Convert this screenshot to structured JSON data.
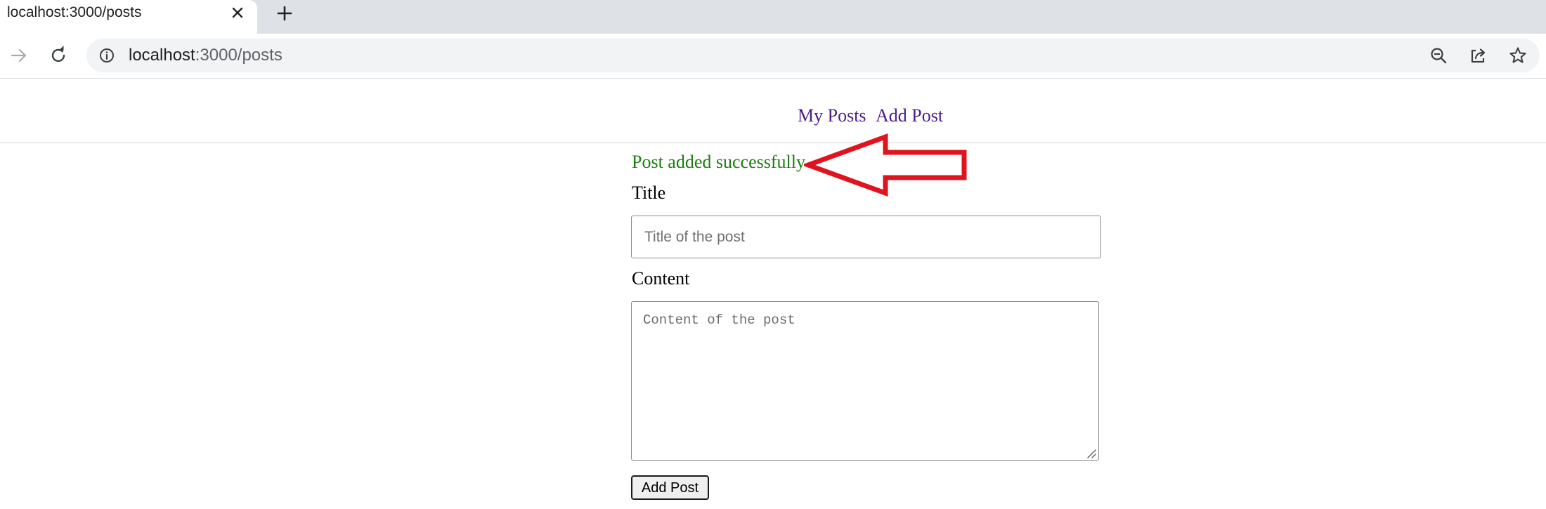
{
  "browser": {
    "tab_title": "localhost:3000/posts",
    "url_host": "localhost",
    "url_path": ":3000/posts"
  },
  "nav": {
    "items": [
      {
        "label": "My Posts"
      },
      {
        "label": "Add Post"
      }
    ]
  },
  "form": {
    "success_message": "Post added successfully",
    "title_label": "Title",
    "title_placeholder": "Title of the post",
    "title_value": "",
    "content_label": "Content",
    "content_placeholder": "Content of the post",
    "submit_label": "Add Post"
  },
  "colors": {
    "link": "#4b1d87",
    "success": "#1c7c12",
    "annotation_arrow": "#e0141e"
  }
}
